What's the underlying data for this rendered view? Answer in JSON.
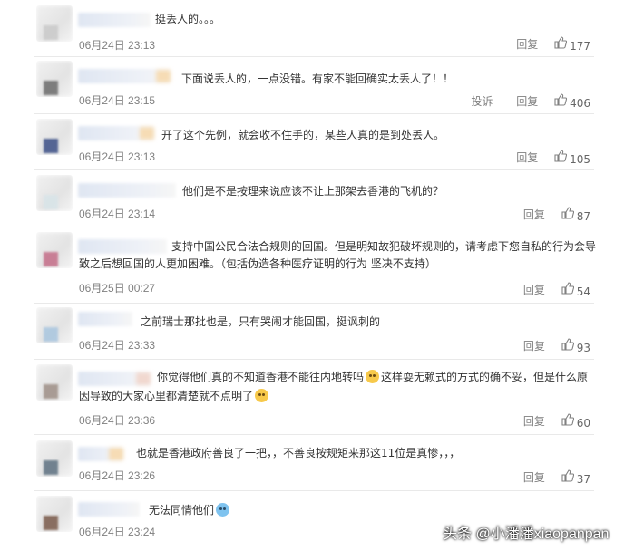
{
  "comments": [
    {
      "text": "挺丢人的。。。",
      "time": "06月24日 23:13",
      "reply_label": "回复",
      "likes": "177"
    },
    {
      "text": "下面说丢人的，一点没错。有家不能回确实太丢人了！！",
      "time": "06月24日 23:15",
      "report_label": "投诉",
      "reply_label": "回复",
      "likes": "406"
    },
    {
      "text": "开了这个先例，就会收不住手的，某些人真的是到处丢人。",
      "time": "06月24日 23:13",
      "reply_label": "回复",
      "likes": "105"
    },
    {
      "text": "他们是不是按理来说应该不让上那架去香港的飞机的？",
      "time": "06月24日 23:14",
      "reply_label": "回复",
      "likes": "87"
    },
    {
      "text": "支持中国公民合法合规则的回国。但是明知故犯破坏规则的，请考虑下您自私的行为会导致之后想回国的人更加困难。（包括伪造各种医疗证明的行为 坚决不支持）",
      "time": "06月25日 00:27",
      "reply_label": "回复",
      "likes": "54"
    },
    {
      "text": "之前瑞士那批也是，只有哭闹才能回国，挺讽刺的",
      "time": "06月24日 23:33",
      "reply_label": "回复",
      "likes": "93"
    },
    {
      "text_a": "你觉得他们真的不知道香港不能往内地转吗",
      "text_b": "这样耍无赖式的方式的确不妥，但是什么原",
      "text_c": "因导致的大家心里都清楚就不点明了",
      "time": "06月24日 23:36",
      "reply_label": "回复",
      "likes": "60"
    },
    {
      "text": "也就是香港政府善良了一把，，不善良按规矩来那这11位是真惨，，，",
      "time": "06月24日 23:26",
      "reply_label": "回复",
      "likes": "37"
    },
    {
      "text": "无法同情他们",
      "time": "06月24日 23:24"
    }
  ],
  "icons": {
    "like": "thumbs-up-icon",
    "emoji_smile": "smile-emoji-icon",
    "emoji_cold": "cold-emoji-icon"
  },
  "watermark": "头条 @小潘潘xiaopanpan"
}
